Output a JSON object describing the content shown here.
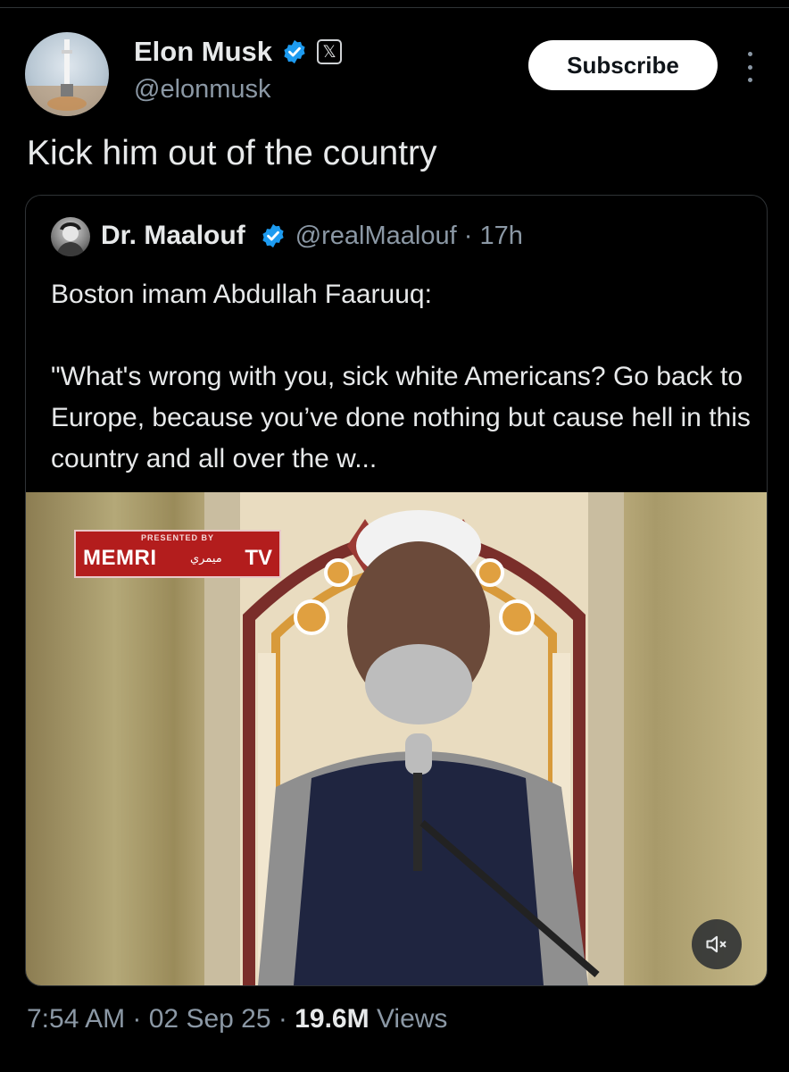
{
  "author": {
    "name": "Elon Musk",
    "handle": "@elonmusk",
    "x_badge": "𝕏"
  },
  "subscribe_label": "Subscribe",
  "tweet_text": "Kick him out of the country",
  "quoted": {
    "name": "Dr. Maalouf",
    "handle_time": "@realMaalouf · 17h",
    "line1": "Boston imam Abdullah Faaruuq:",
    "line2": "\"What's wrong with you, sick white Americans? Go back to Europe, because you’ve done nothing but cause hell in this country and all over the w...",
    "video": {
      "watermark_presented": "PRESENTED BY",
      "watermark_brand": "MEMRI",
      "watermark_arabic": "ميمري",
      "watermark_tv": "TV"
    }
  },
  "meta": {
    "time": "7:54 AM",
    "date": "02 Sep 25",
    "views_count": "19.6M",
    "views_label": "Views"
  },
  "colors": {
    "background": "#000000",
    "text": "#e7e9ea",
    "secondary": "#8b98a5",
    "verified": "#1d9bf0"
  },
  "icons": [
    "verified-icon",
    "x-badge-icon",
    "more-icon",
    "mute-icon"
  ]
}
